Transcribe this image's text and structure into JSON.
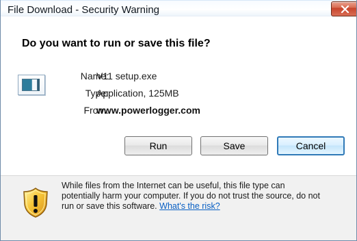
{
  "window": {
    "title": "File Download - Security Warning"
  },
  "dialog": {
    "question": "Do you want to run or save this file?",
    "details": {
      "name_label": "Name:",
      "name_value": "V11 setup.exe",
      "type_label": "Type:",
      "type_value": "Application, 125MB",
      "from_label": "From:",
      "from_value": "www.powerlogger.com"
    },
    "buttons": {
      "run": "Run",
      "save": "Save",
      "cancel": "Cancel"
    }
  },
  "warning": {
    "line1": "While files from the Internet can be useful, this file type can",
    "line2": "potentially harm your computer. If you do not trust the source, do not",
    "line3_prefix": "run or save this software.",
    "risk_link": "What's the risk?"
  },
  "icons": {
    "close": "close-icon",
    "file": "application-file-icon",
    "warning": "security-shield-icon"
  },
  "colors": {
    "close_red": "#d86b51",
    "focus_blue": "#2f79b7",
    "link_blue": "#075ec3",
    "warning_background": "#f1f1f1"
  }
}
